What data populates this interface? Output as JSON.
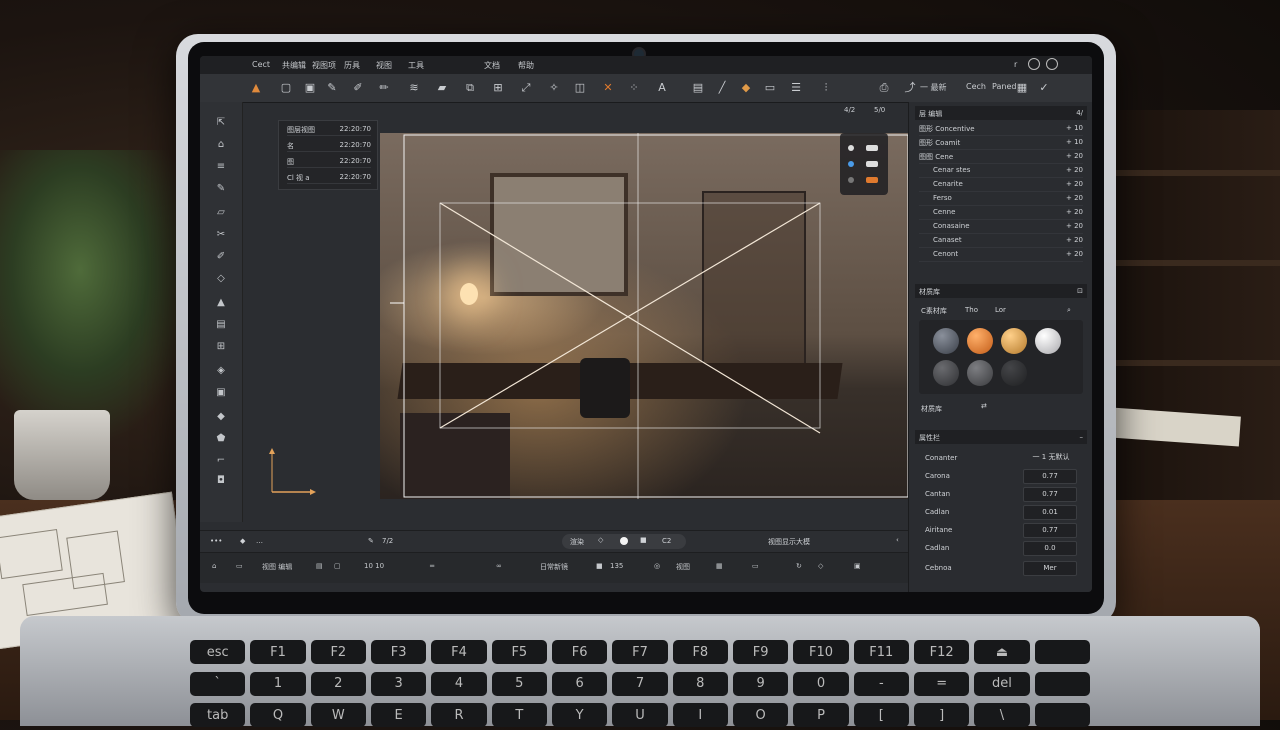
{
  "menubar": {
    "app_label": "Cect",
    "items": [
      "共编辑",
      "视图项",
      "历具",
      "视图",
      "工具",
      "文档",
      "帮助"
    ]
  },
  "toolbar": {
    "right_labels": [
      "一 最新",
      "Cech",
      "Paned"
    ]
  },
  "layers": [
    {
      "name": "图层视图",
      "time": "22:20:70"
    },
    {
      "name": "名",
      "time": "22:20:70"
    },
    {
      "name": "图",
      "time": "22:20:70"
    },
    {
      "name": "Cl 视 a",
      "time": "22:20:70"
    }
  ],
  "viewport": {
    "hud_labels": [
      "4/2",
      "5/0"
    ]
  },
  "right_panel": {
    "header": "层 编辑",
    "header_right": "4/",
    "objects": [
      {
        "name": "图形 Concentive",
        "val": "+ 10"
      },
      {
        "name": "图形 Coamit",
        "val": "+ 10"
      },
      {
        "name": "图图 Cene",
        "val": "+ 20"
      },
      {
        "name": "Cenar stes",
        "val": "+ 20"
      },
      {
        "name": "Cenarite",
        "val": "+ 20"
      },
      {
        "name": "Ferso",
        "val": "+ 20"
      },
      {
        "name": "Cenne",
        "val": "+ 20"
      },
      {
        "name": "Conasaine",
        "val": "+ 20"
      },
      {
        "name": "Canaset",
        "val": "+ 20"
      },
      {
        "name": "Cenont",
        "val": "+ 20"
      }
    ],
    "materials_header": "材质库",
    "materials_tabs": [
      "C素材库",
      "Tho",
      "Lor"
    ],
    "materials_footer": "材质库",
    "swatch_colors": [
      "#5a5f68",
      "#e07a2e",
      "#d99a44",
      "#d9d9dc",
      "#4a4b4f",
      "#5b5c60",
      "#2d2e31"
    ],
    "props_header": "属性栏",
    "props": [
      {
        "key": "Conanter",
        "val": "一 1 无默认"
      },
      {
        "key": "Carona",
        "val": "0.77"
      },
      {
        "key": "Cantan",
        "val": "0.77"
      },
      {
        "key": "Cadlan",
        "val": "0.01"
      },
      {
        "key": "Airitane",
        "val": "0.77"
      },
      {
        "key": "Cadlan",
        "val": "0.0"
      },
      {
        "key": "Cebnoa",
        "val": "Mer"
      }
    ]
  },
  "statusbar": {
    "left": "…",
    "tool": "7/2",
    "mode": "渲染",
    "mode2": "C2",
    "title": "视图显示大模"
  },
  "bottombar": {
    "items": [
      "视图 编辑",
      "10 10",
      "日常新镜",
      "135",
      "视图"
    ]
  },
  "keyboard": {
    "row1": [
      "esc",
      "F1",
      "F2",
      "F3",
      "F4",
      "F5",
      "F6",
      "F7",
      "F8",
      "F9",
      "F10",
      "F11",
      "F12",
      "⏏",
      ""
    ],
    "row2": [
      "`",
      "1",
      "2",
      "3",
      "4",
      "5",
      "6",
      "7",
      "8",
      "9",
      "0",
      "-",
      "=",
      "del",
      ""
    ],
    "row3": [
      "tab",
      "Q",
      "W",
      "E",
      "R",
      "T",
      "Y",
      "U",
      "I",
      "O",
      "P",
      "[",
      "]",
      "\\",
      ""
    ]
  }
}
